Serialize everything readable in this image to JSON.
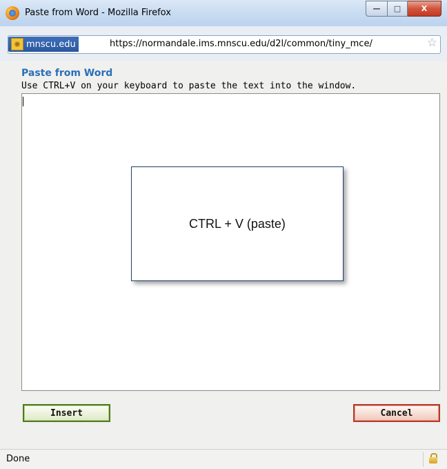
{
  "window": {
    "title": "Paste from Word - Mozilla Firefox",
    "controls": {
      "minimize": "—",
      "maximize": "□",
      "close": "X"
    }
  },
  "address_bar": {
    "site_domain": "mnscu.edu",
    "url": "https://normandale.ims.mnscu.edu/d2l/common/tiny_mce/",
    "bookmark_icon": "star-icon"
  },
  "dialog": {
    "heading": "Paste from Word",
    "instruction": "Use CTRL+V on your keyboard to paste the text into the window.",
    "callout_text": "CTRL + V  (paste)",
    "insert_label": "Insert",
    "cancel_label": "Cancel"
  },
  "status_bar": {
    "text": "Done",
    "lock_icon": "padlock-icon"
  },
  "colors": {
    "heading": "#2b6fb8",
    "insert_border": "#4e7a22",
    "cancel_border": "#b43a2a",
    "site_badge": "#2a57a0"
  }
}
